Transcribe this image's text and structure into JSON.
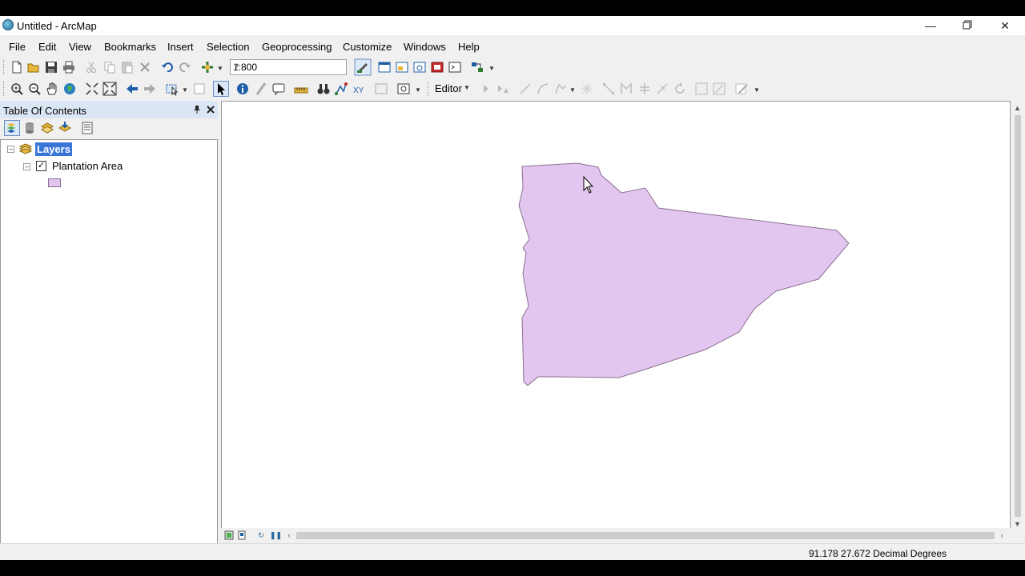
{
  "window": {
    "title": "Untitled - ArcMap"
  },
  "menu": [
    "File",
    "Edit",
    "View",
    "Bookmarks",
    "Insert",
    "Selection",
    "Geoprocessing",
    "Customize",
    "Windows",
    "Help"
  ],
  "toolbar": {
    "scale_value": "1:800",
    "editor_label": "Editor"
  },
  "toc": {
    "title": "Table Of Contents",
    "data_frame": "Layers",
    "layer": {
      "name": "Plantation Area",
      "checked": "✓",
      "fill_color": "#e2c6ef",
      "outline_color": "#8a7090"
    }
  },
  "status": {
    "coordinates": "91.178  27.672 Decimal Degrees"
  },
  "colors": {
    "selection_highlight": "#3875d7",
    "toc_header": "#dbe6f4",
    "polygon_fill": "#e2c6ef"
  }
}
